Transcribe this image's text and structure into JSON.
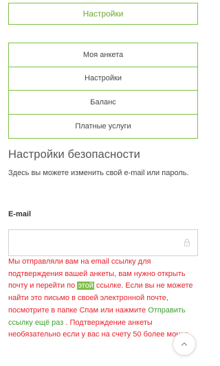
{
  "top_button": {
    "label": "Настройки"
  },
  "menu": {
    "items": [
      {
        "label": "Моя анкета"
      },
      {
        "label": "Настройки"
      },
      {
        "label": "Баланс"
      },
      {
        "label": "Платные услуги"
      }
    ]
  },
  "security": {
    "title": "Настройки безопасности",
    "description": "Здесь вы можете изменить свой e-mail или пароль."
  },
  "email": {
    "label": "E-mail",
    "value": "",
    "placeholder": "",
    "icon": "lock-icon"
  },
  "notice": {
    "part1": "Мы отправляли вам на email ссылку для подтверждения вашей анкеты, вам нужно открыть почту и перейти по ",
    "link_text": "этой",
    "part2": " ссылке. Если вы не можете найти это письмо в своей электронной почте, посмотрите в папке Спам или нажмите ",
    "resend_link": "Отправить ссылку ещё раз",
    "part3": " . Подтверждение анкеты необязательно если у вас на счету 50",
    "part3_tail": " более монет."
  },
  "scroll_top": {
    "icon": "chevron-up-icon"
  },
  "colors": {
    "accent": "#7cc142",
    "warning": "#e8202a",
    "link_green": "#3e9e2f"
  }
}
